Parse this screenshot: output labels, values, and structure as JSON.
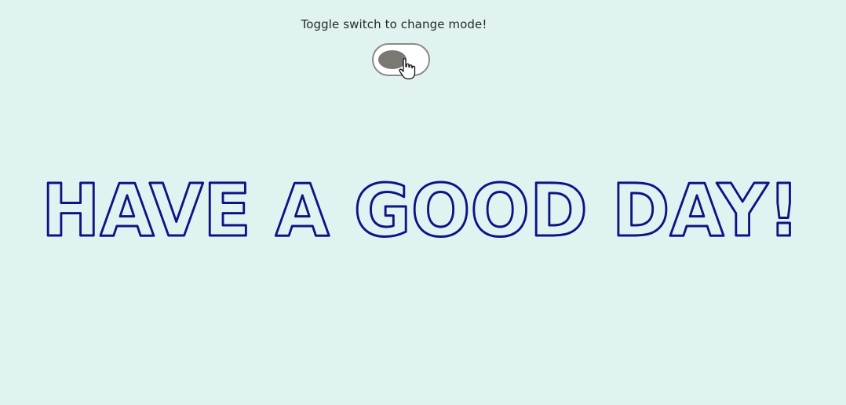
{
  "prompt": {
    "text": "Toggle switch to change mode!"
  },
  "mode_toggle": {
    "state": "off",
    "knob_color": "#7a7873",
    "track_color": "#ffffff",
    "border_color": "#8a8a8a"
  },
  "cursor": {
    "icon": "hand-pointer-icon"
  },
  "headline": {
    "text": "HAVE A GOOD DAY!",
    "outline_color": "#0d1585"
  },
  "colors": {
    "background": "#e1f3f1"
  }
}
